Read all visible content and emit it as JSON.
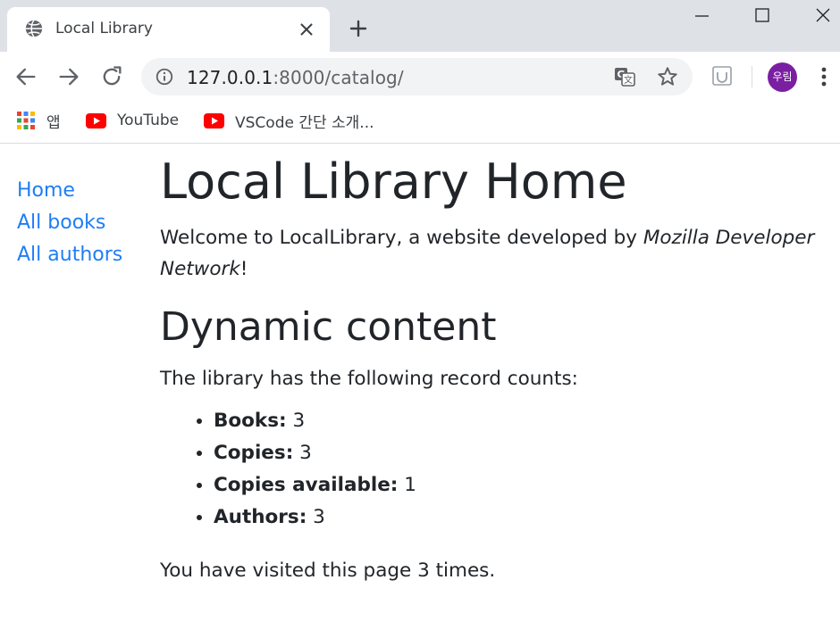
{
  "browser": {
    "tab_title": "Local Library",
    "url_host": "127.0.0.1",
    "url_path": ":8000/catalog/",
    "avatar_text": "우림",
    "bookmarks": [
      "앱",
      "YouTube",
      "VSCode 간단 소개..."
    ]
  },
  "sidebar": {
    "links": [
      "Home",
      "All books",
      "All authors"
    ]
  },
  "main": {
    "title": "Local Library Home",
    "welcome_prefix": "Welcome to LocalLibrary, a website developed by ",
    "welcome_emphasis": "Mozilla Developer Network",
    "welcome_suffix": "!",
    "section_title": "Dynamic content",
    "counts_intro": "The library has the following record counts:",
    "counts": [
      {
        "label": "Books:",
        "value": "3"
      },
      {
        "label": "Copies:",
        "value": "3"
      },
      {
        "label": "Copies available:",
        "value": "1"
      },
      {
        "label": "Authors:",
        "value": "3"
      }
    ],
    "visits_text": "You have visited this page 3 times."
  },
  "colors": {
    "link": "#1e7ef5",
    "avatar": "#7b1fa2",
    "youtube": "#ff0000"
  },
  "icons": [
    "globe-icon",
    "close-icon",
    "plus-icon",
    "back-icon",
    "forward-icon",
    "reload-icon",
    "info-icon",
    "translate-icon",
    "star-icon",
    "extension-icon",
    "kebab-icon",
    "apps-icon",
    "youtube-icon"
  ]
}
